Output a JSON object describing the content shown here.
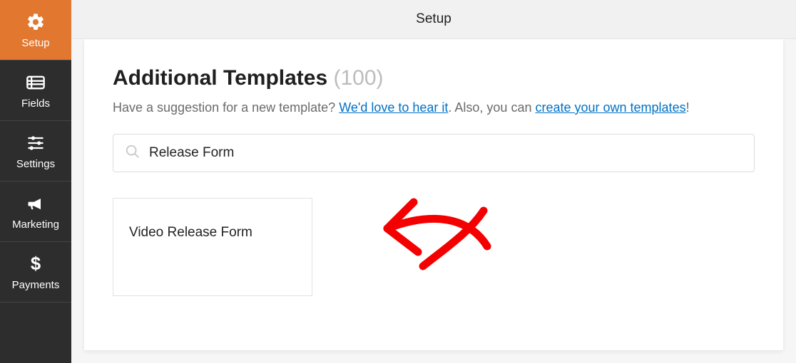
{
  "topbar": {
    "title": "Setup"
  },
  "sidebar": {
    "items": [
      {
        "label": "Setup"
      },
      {
        "label": "Fields"
      },
      {
        "label": "Settings"
      },
      {
        "label": "Marketing"
      },
      {
        "label": "Payments"
      }
    ]
  },
  "content": {
    "heading": "Additional Templates",
    "count": "(100)",
    "subtext_prefix": "Have a suggestion for a new template? ",
    "link_hear": "We'd love to hear it",
    "subtext_mid": ". Also, you can ",
    "link_create": "create your own templates",
    "subtext_suffix": "!",
    "search_value": "Release Form",
    "result_label": "Video Release Form"
  }
}
